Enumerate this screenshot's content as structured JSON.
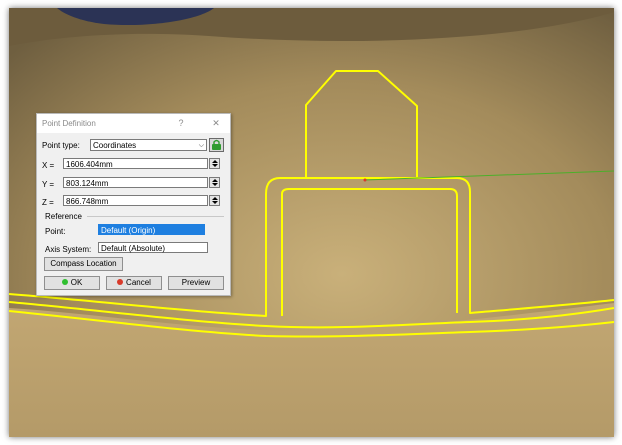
{
  "dialog": {
    "title": "Point Definition",
    "help_glyph": "?",
    "close_glyph": "✕",
    "point_type_label": "Point type:",
    "point_type_value": "Coordinates",
    "x_label": "X =",
    "x_value": "1606.404mm",
    "y_label": "Y =",
    "y_value": "803.124mm",
    "z_label": "Z =",
    "z_value": "866.748mm",
    "reference_label": "Reference",
    "point_label": "Point:",
    "point_value": "Default (Origin)",
    "axis_label": "Axis System:",
    "axis_value": "Default (Absolute)",
    "compass_button": "Compass Location",
    "ok_button": "OK",
    "cancel_button": "Cancel",
    "preview_button": "Preview"
  },
  "colors": {
    "surface": "#a8915f",
    "profile": "#ffff00",
    "direction_line": "#4caf2a",
    "selection": "#1e7fe0",
    "ok_dot": "#2fbf2f",
    "cancel_dot": "#d83a2a"
  },
  "icons": {
    "point_type_tool": "lock-chain-icon",
    "spinner": "spinner-arrows-icon"
  }
}
